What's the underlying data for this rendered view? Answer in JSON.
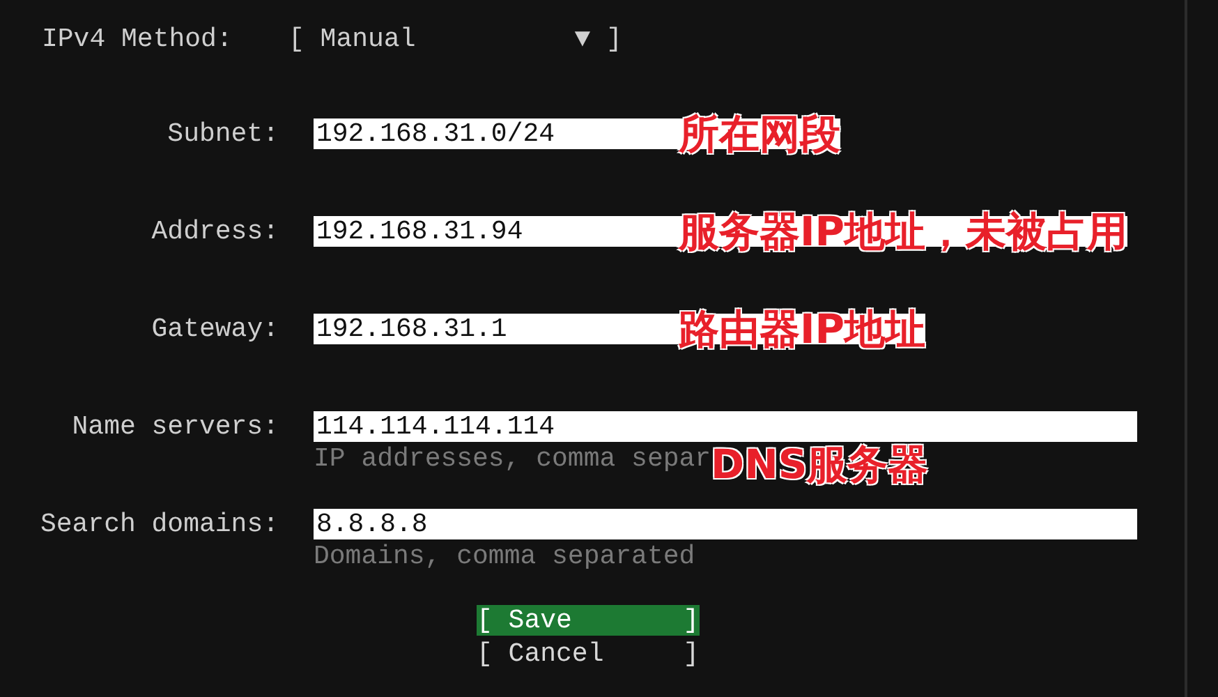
{
  "method": {
    "label": "IPv4 Method:",
    "value": "[ Manual          ▼ ]"
  },
  "fields": [
    {
      "label": "Subnet:",
      "value": "192.168.31.0/24",
      "annotation": "所在网段"
    },
    {
      "label": "Address:",
      "value": "192.168.31.94",
      "annotation": "服务器IP地址，未被占用"
    },
    {
      "label": "Gateway:",
      "value": "192.168.31.1",
      "annotation": "路由器IP地址"
    },
    {
      "label": "Name servers:",
      "value": "114.114.114.114",
      "hint": "IP addresses, comma separ",
      "annotation": "DNS服务器"
    },
    {
      "label": "Search domains:",
      "value": "8.8.8.8",
      "hint": "Domains, comma separated"
    }
  ],
  "buttons": [
    {
      "label": "[ Save       ]",
      "selected": true
    },
    {
      "label": "[ Cancel     ]",
      "selected": false
    }
  ]
}
